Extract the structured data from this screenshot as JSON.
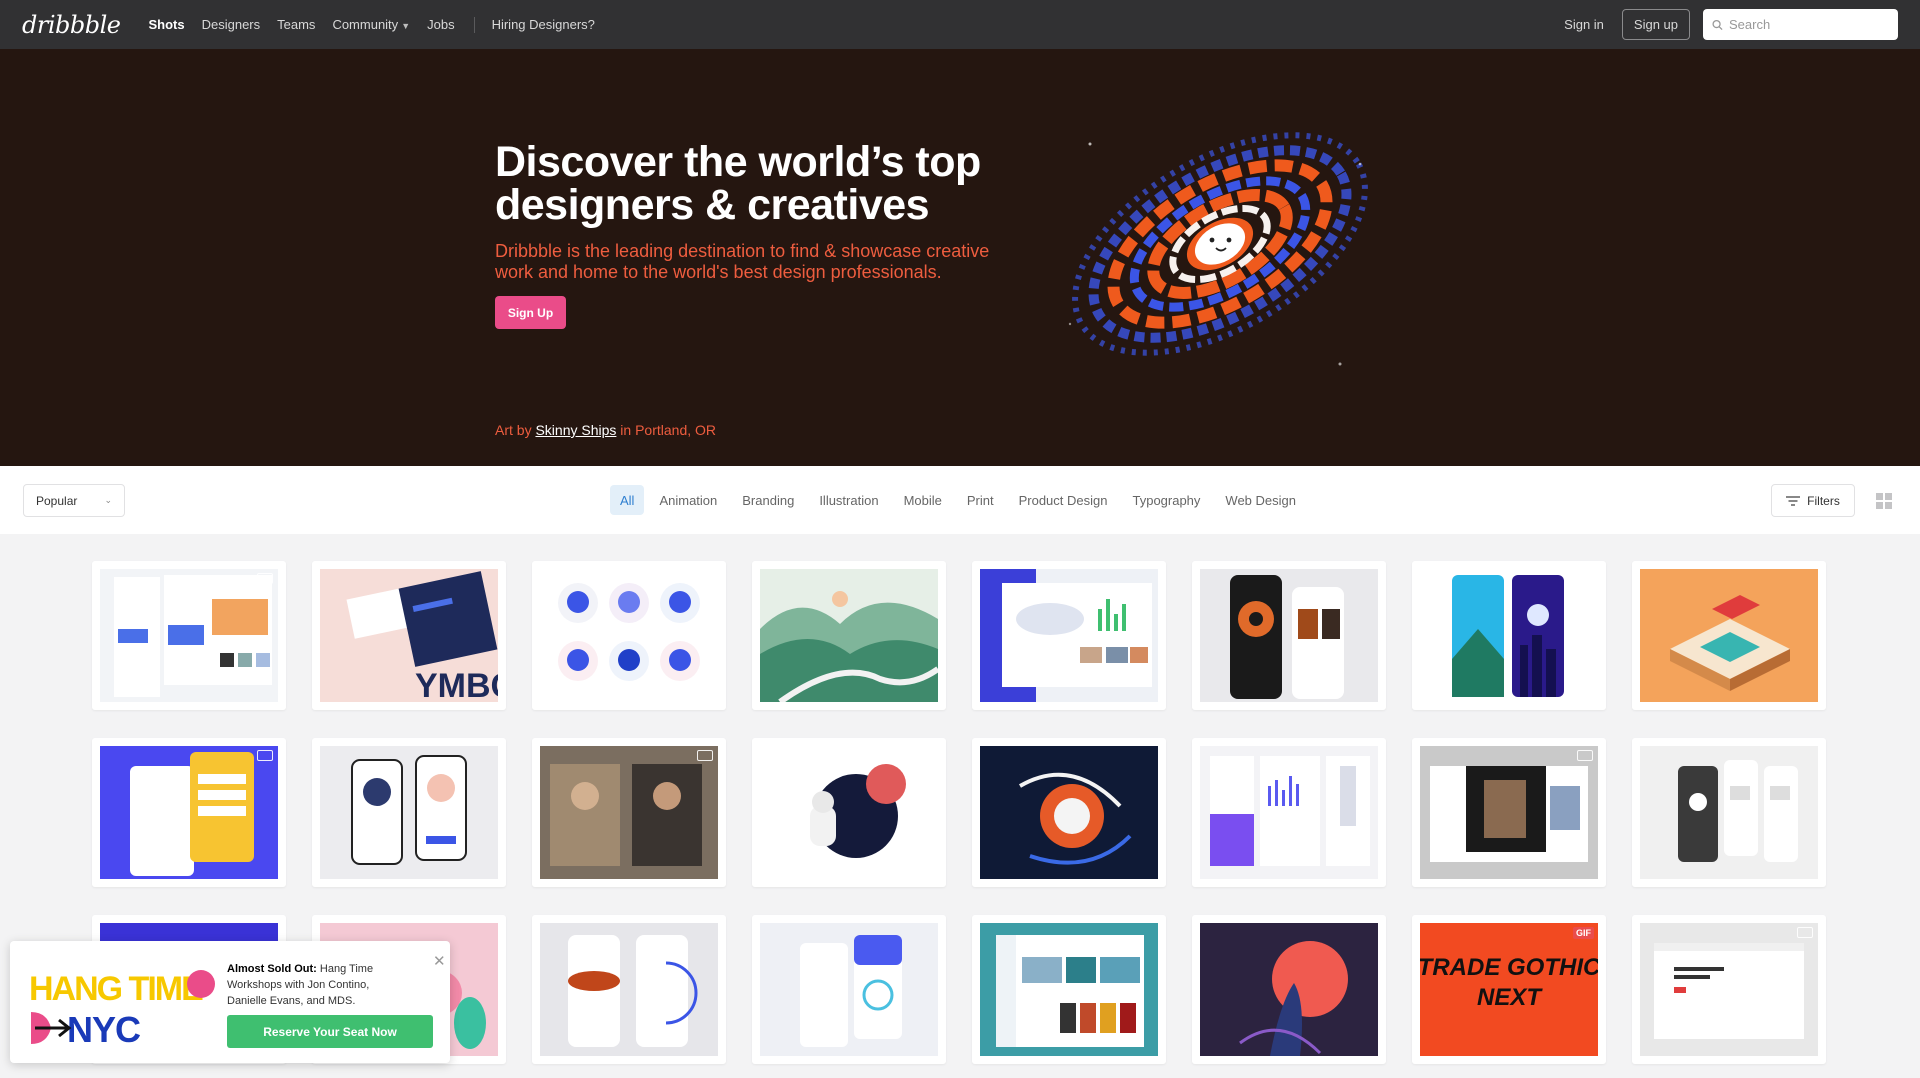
{
  "header": {
    "logo": "dribbble",
    "nav": [
      {
        "label": "Shots",
        "active": true
      },
      {
        "label": "Designers"
      },
      {
        "label": "Teams"
      },
      {
        "label": "Community"
      },
      {
        "label": "Jobs"
      }
    ],
    "hiring": "Hiring Designers?",
    "signin": "Sign in",
    "signup": "Sign up",
    "search_placeholder": "Search"
  },
  "hero": {
    "title_line1": "Discover the world’s top",
    "title_line2": "designers & creatives",
    "subtitle": "Dribbble is the leading destination to find & showcase creative work and home to the world's best design professionals.",
    "cta": "Sign Up",
    "credit_prefix": "Art by",
    "credit_artist": "Skinny Ships",
    "credit_suffix": "in Portland, OR"
  },
  "filters": {
    "sort_selected": "Popular",
    "categories": [
      "All",
      "Animation",
      "Branding",
      "Illustration",
      "Mobile",
      "Print",
      "Product Design",
      "Typography",
      "Web Design"
    ],
    "active_category": "All",
    "filters_label": "Filters"
  },
  "shots": [
    {
      "bg": "#f2f4f7",
      "badge": "video"
    },
    {
      "bg": "#f6ddd8",
      "badge": ""
    },
    {
      "bg": "#ffffff",
      "badge": ""
    },
    {
      "bg": "#d9e8df",
      "badge": ""
    },
    {
      "bg": "#eef1f6",
      "badge": ""
    },
    {
      "bg": "#e9e9ec",
      "badge": ""
    },
    {
      "bg": "#ffffff",
      "badge": ""
    },
    {
      "bg": "#f1a35a",
      "badge": ""
    },
    {
      "bg": "#4a48f0",
      "badge": "video"
    },
    {
      "bg": "#ececef",
      "badge": ""
    },
    {
      "bg": "#6e6458",
      "badge": "video"
    },
    {
      "bg": "#ffffff",
      "badge": ""
    },
    {
      "bg": "#101a35",
      "badge": ""
    },
    {
      "bg": "#f3f3f6",
      "badge": ""
    },
    {
      "bg": "#c9c9c9",
      "badge": "video"
    },
    {
      "bg": "#f0f0f0",
      "badge": ""
    },
    {
      "bg": "#3a32d6",
      "badge": ""
    },
    {
      "bg": "#f4c9d4",
      "badge": ""
    },
    {
      "bg": "#e6e6ea",
      "badge": ""
    },
    {
      "bg": "#eef0f5",
      "badge": ""
    },
    {
      "bg": "#3c9da6",
      "badge": ""
    },
    {
      "bg": "#2c2340",
      "badge": ""
    },
    {
      "bg": "#f24a21",
      "badge": "gif"
    },
    {
      "bg": "#e8e8e8",
      "badge": "video"
    }
  ],
  "shot_text": {
    "trade_gothic_1": "TRADE GOTHIC",
    "trade_gothic_2": "NEXT",
    "gif": "GIF"
  },
  "promo": {
    "bold": "Almost Sold Out:",
    "text": "Hang Time Workshops with Jon Contino, Danielle Evans, and MDS.",
    "cta": "Reserve Your Seat Now",
    "close": "✕",
    "art_line1": "HANG TIME",
    "art_line2": "NYC"
  },
  "colors": {
    "accent": "#ea4c89",
    "hero_bg": "#251610",
    "hero_sub": "#ee5d3f",
    "promo_green": "#3fbf70"
  }
}
